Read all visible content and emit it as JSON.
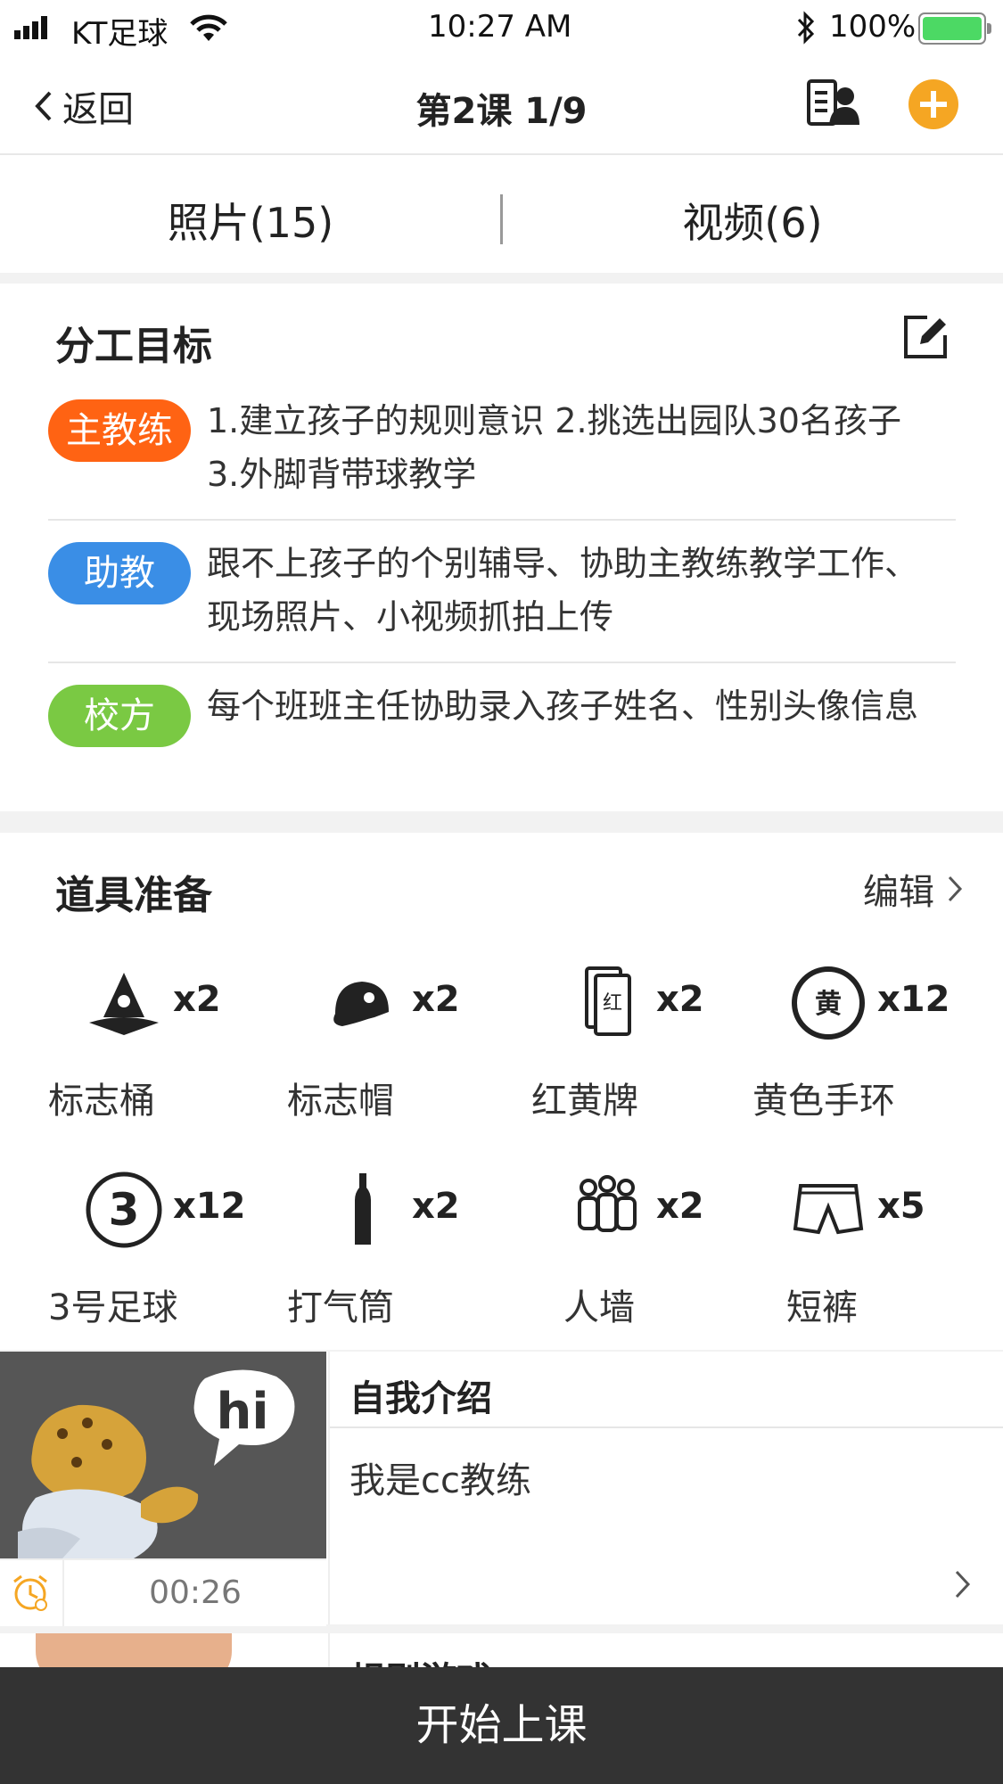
{
  "status_bar": {
    "carrier": "KT足球",
    "time": "10:27 AM",
    "battery": "100%",
    "battery_color": "#4cd964"
  },
  "nav": {
    "back_label": "返回",
    "title": "第2课 1/9",
    "add_color": "#f5a623"
  },
  "tabs": [
    {
      "label": "照片(15)"
    },
    {
      "label": "视频(6)"
    }
  ],
  "division": {
    "title": "分工目标",
    "roles": [
      {
        "badge": "主教练",
        "color": "#ff6313",
        "text": "1.建立孩子的规则意识 2.挑选出园队30名孩子 3.外脚背带球教学"
      },
      {
        "badge": "助教",
        "color": "#3a8ee6",
        "text": "跟不上孩子的个别辅导、协助主教练教学工作、现场照片、小视频抓拍上传"
      },
      {
        "badge": "校方",
        "color": "#7ac943",
        "text": "每个班班主任协助录入孩子姓名、性别头像信息"
      }
    ]
  },
  "props": {
    "title": "道具准备",
    "edit_label": "编辑",
    "items": [
      {
        "icon": "cone-icon",
        "qty": "x2",
        "label": "标志桶"
      },
      {
        "icon": "cap-icon",
        "qty": "x2",
        "label": "标志帽"
      },
      {
        "icon": "card-icon",
        "icon_text": "红",
        "qty": "x2",
        "label": "红黄牌"
      },
      {
        "icon": "wristband-icon",
        "icon_text": "黄",
        "qty": "x12",
        "label": "黄色手环"
      },
      {
        "icon": "ball-size-icon",
        "icon_text": "3",
        "qty": "x12",
        "label": "3号足球"
      },
      {
        "icon": "pump-icon",
        "qty": "x2",
        "label": "打气筒"
      },
      {
        "icon": "wall-icon",
        "qty": "x2",
        "label": "人墙"
      },
      {
        "icon": "shorts-icon",
        "qty": "x5",
        "label": "短裤"
      }
    ]
  },
  "lessons": [
    {
      "title": "自我介绍",
      "desc": "我是cc教练",
      "duration": "00:26",
      "thumb_text": "hi"
    },
    {
      "title": "规则游戏"
    }
  ],
  "bottom_button": "开始上课"
}
